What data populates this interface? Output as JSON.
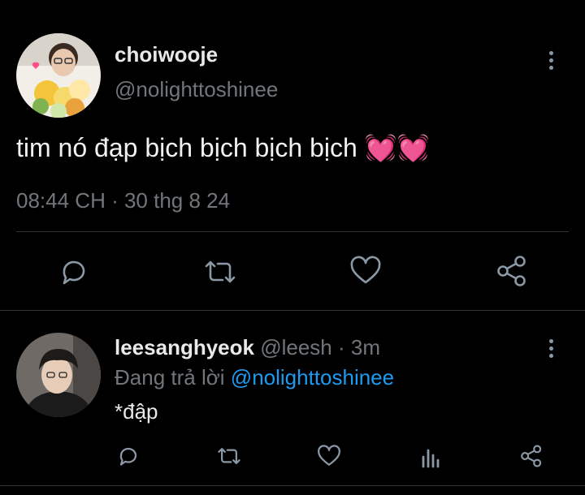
{
  "main_tweet": {
    "display_name": "choiwooje",
    "handle": "@nolighttoshinee",
    "text": "tim nó đạp bịch bịch bịch bịch 💓💓",
    "timestamp": "08:44 CH · 30 thg 8 24",
    "actions": [
      "reply-icon",
      "retweet-icon",
      "like-icon",
      "share-icon"
    ]
  },
  "reply": {
    "display_name": "leesanghyeok",
    "handle": "@leesh",
    "time": "· 3m",
    "replying_prefix": "Đang trả lời",
    "replying_to": "@nolighttoshinee",
    "text": "*đập",
    "actions": [
      "reply-icon",
      "retweet-icon",
      "like-icon",
      "views-icon",
      "share-icon"
    ]
  },
  "colors": {
    "background": "#000000",
    "text": "#e7e9ea",
    "muted": "#71767b",
    "link": "#1d9bf0",
    "divider": "#2f3336",
    "icon": "#8b98a5"
  }
}
